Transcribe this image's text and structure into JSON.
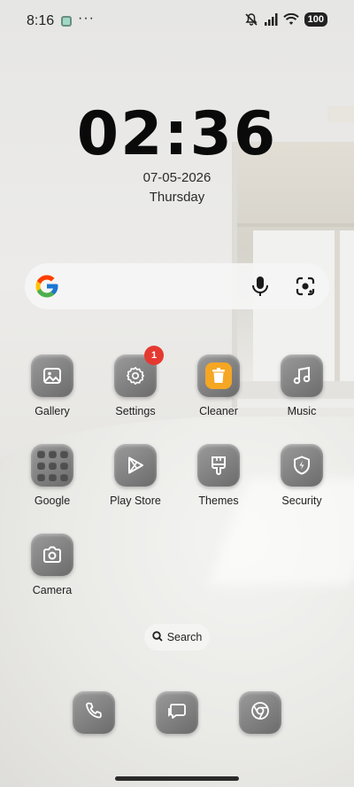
{
  "status_bar": {
    "time": "8:16",
    "more": "···",
    "battery": "100"
  },
  "clock": {
    "time": "02:36",
    "date": "07-05-2026",
    "day": "Thursday"
  },
  "apps": [
    {
      "label": "Gallery",
      "icon": "gallery-icon"
    },
    {
      "label": "Settings",
      "icon": "gear-icon",
      "badge": "1"
    },
    {
      "label": "Cleaner",
      "icon": "trash-icon"
    },
    {
      "label": "Music",
      "icon": "music-note-icon"
    },
    {
      "label": "Google",
      "icon": "google-folder-icon"
    },
    {
      "label": "Play Store",
      "icon": "play-store-icon"
    },
    {
      "label": "Themes",
      "icon": "paintbrush-icon"
    },
    {
      "label": "Security",
      "icon": "shield-icon"
    },
    {
      "label": "Camera",
      "icon": "camera-icon"
    }
  ],
  "search_pill": {
    "label": "Search"
  },
  "dock": [
    {
      "icon": "phone-icon"
    },
    {
      "icon": "messages-icon"
    },
    {
      "icon": "chrome-icon"
    }
  ],
  "colors": {
    "badge": "#e53930",
    "cleaner": "#f5a623"
  }
}
